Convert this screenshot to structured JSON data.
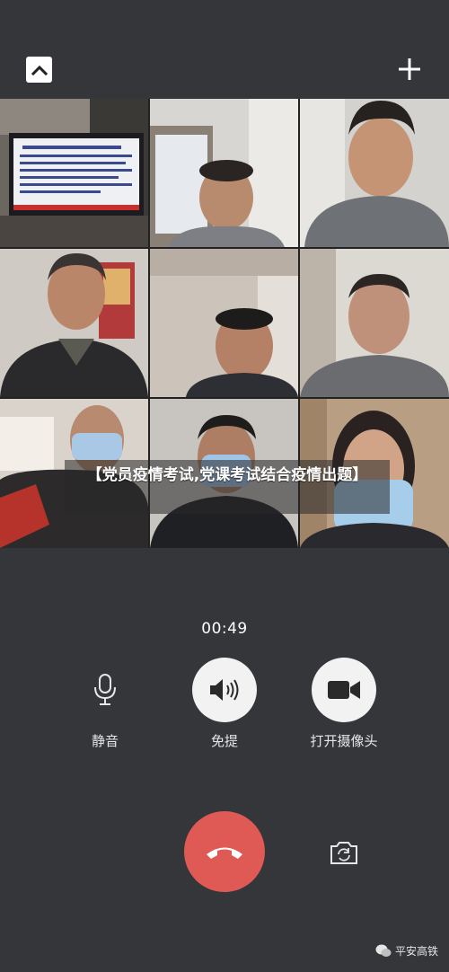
{
  "call": {
    "banner": "【党员疫情考试,党课考试结合疫情出题】",
    "timer": "00:49"
  },
  "controls": {
    "mute_label": "静音",
    "speaker_label": "免提",
    "camera_label": "打开摄像头"
  },
  "watermark": {
    "text": "平安高铁",
    "icon": "wechat-icon"
  },
  "icons": {
    "collapse": "chevron-up-icon",
    "add": "plus-icon",
    "mute": "microphone-icon",
    "speaker": "speaker-icon",
    "camera": "video-camera-icon",
    "hangup": "phone-hangup-icon",
    "switch_camera": "camera-switch-icon"
  },
  "colors": {
    "background": "#34363a",
    "hangup": "#e05a55"
  }
}
